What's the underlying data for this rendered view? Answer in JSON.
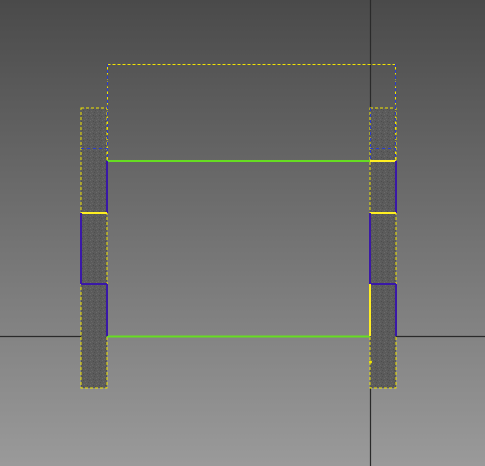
{
  "viewport": {
    "background_top": "#4a4a4a",
    "background_bottom": "#9a9a9a"
  },
  "colors": {
    "axis": "#2a2a2a",
    "selection_dash": "#f2e600",
    "hidden_edge_dash": "#2a3bd0",
    "edge_green": "#66dd22",
    "edge_yellow": "#ffee22",
    "edge_purple": "#3a18a8",
    "pillar_fill": "#5a5a5a"
  }
}
